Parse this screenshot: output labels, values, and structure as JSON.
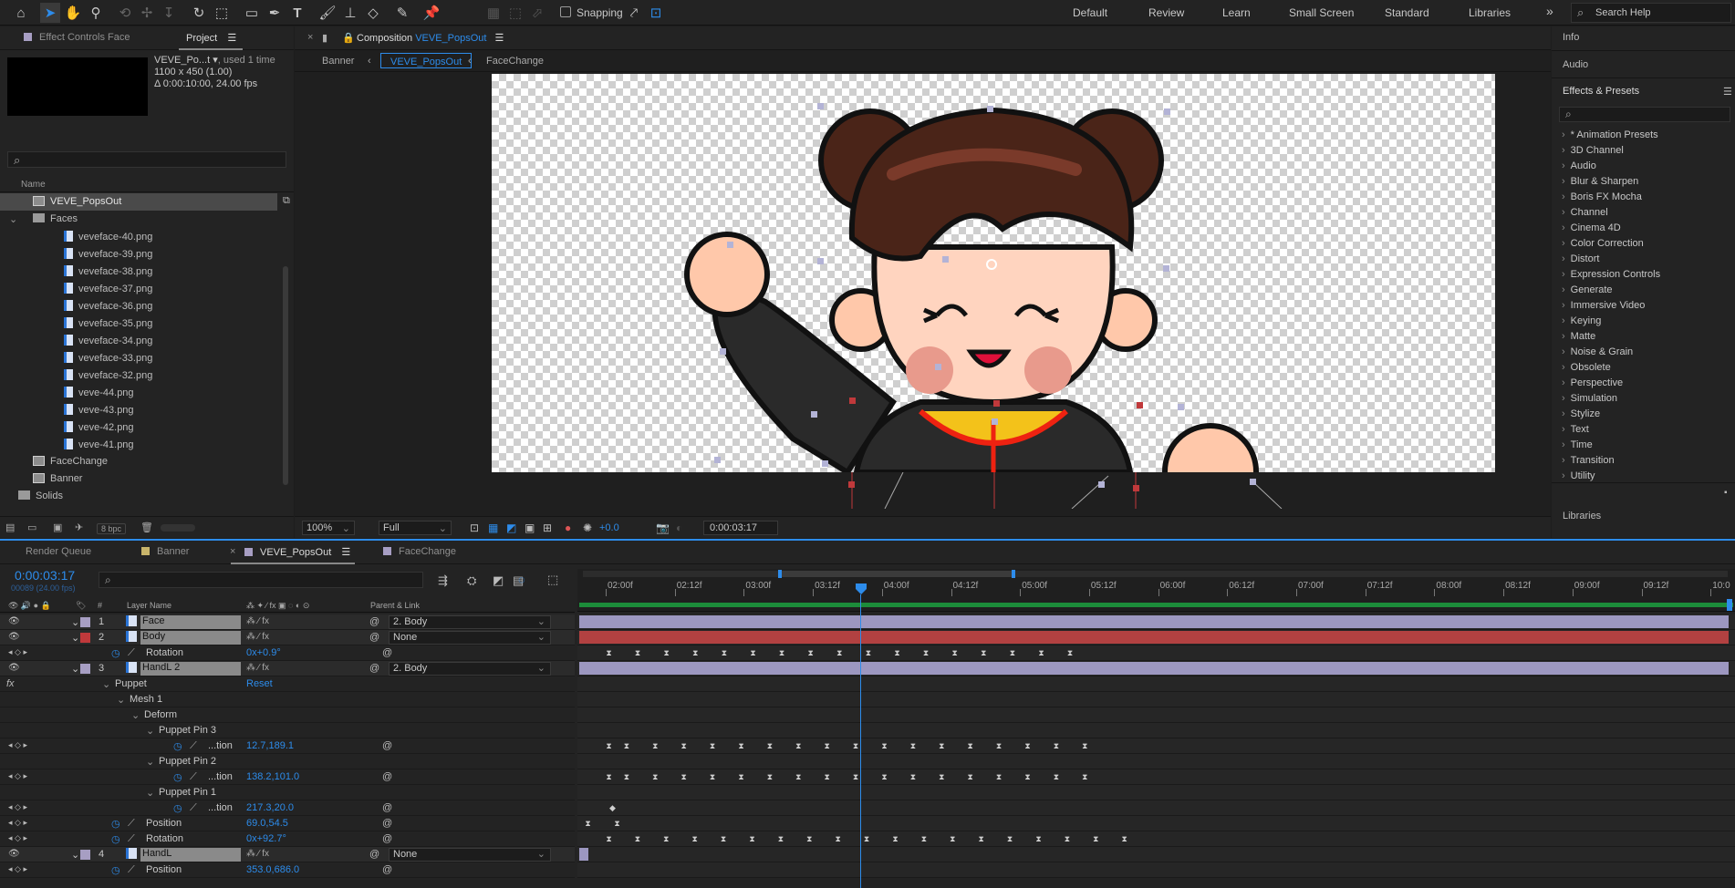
{
  "toolbar": {
    "snapping_label": "Snapping",
    "workspaces": [
      "Default",
      "Review",
      "Learn",
      "Small Screen",
      "Standard",
      "Libraries"
    ],
    "more": "»",
    "search_placeholder": "Search Help"
  },
  "project": {
    "tabs": {
      "effect_controls": "Effect Controls Face",
      "project": "Project"
    },
    "info": {
      "name": "VEVE_Po...t ▾",
      "used": ", used 1 time",
      "dimensions": "1100 x 450 (1.00)",
      "duration": "Δ 0:00:10:00, 24.00 fps"
    },
    "search_icon": "⌕",
    "column_name": "Name",
    "items": [
      {
        "label": "VEVE_PopsOut",
        "kind": "comp",
        "depth": 1,
        "selected": true
      },
      {
        "label": "Faces",
        "kind": "folder",
        "depth": 1,
        "expand": "⌄"
      },
      {
        "label": "veveface-40.png",
        "kind": "file",
        "depth": 2
      },
      {
        "label": "veveface-39.png",
        "kind": "file",
        "depth": 2
      },
      {
        "label": "veveface-38.png",
        "kind": "file",
        "depth": 2
      },
      {
        "label": "veveface-37.png",
        "kind": "file",
        "depth": 2
      },
      {
        "label": "veveface-36.png",
        "kind": "file",
        "depth": 2
      },
      {
        "label": "veveface-35.png",
        "kind": "file",
        "depth": 2
      },
      {
        "label": "veveface-34.png",
        "kind": "file",
        "depth": 2
      },
      {
        "label": "veveface-33.png",
        "kind": "file",
        "depth": 2
      },
      {
        "label": "veveface-32.png",
        "kind": "file",
        "depth": 2
      },
      {
        "label": "veve-44.png",
        "kind": "file",
        "depth": 2
      },
      {
        "label": "veve-43.png",
        "kind": "file",
        "depth": 2
      },
      {
        "label": "veve-42.png",
        "kind": "file",
        "depth": 2
      },
      {
        "label": "veve-41.png",
        "kind": "file",
        "depth": 2
      },
      {
        "label": "FaceChange",
        "kind": "comp",
        "depth": 1
      },
      {
        "label": "Banner",
        "kind": "comp",
        "depth": 1
      },
      {
        "label": "Solids",
        "kind": "folder",
        "depth": 0,
        "expand": "›"
      }
    ],
    "bpc": "8 bpc"
  },
  "composition": {
    "tab_prefix": "Composition",
    "tab_name": "VEVE_PopsOut",
    "breadcrumbs": [
      "Banner",
      "VEVE_PopsOut",
      "FaceChange"
    ],
    "footer": {
      "zoom": "100%",
      "quality": "Full",
      "exposure": "+0.0",
      "time": "0:00:03:17"
    }
  },
  "right": {
    "info": "Info",
    "audio": "Audio",
    "effects_title": "Effects & Presets",
    "search_icon": "⌕",
    "effects": [
      "* Animation Presets",
      "3D Channel",
      "Audio",
      "Blur & Sharpen",
      "Boris FX Mocha",
      "Channel",
      "Cinema 4D",
      "Color Correction",
      "Distort",
      "Expression Controls",
      "Generate",
      "Immersive Video",
      "Keying",
      "Matte",
      "Noise & Grain",
      "Obsolete",
      "Perspective",
      "Simulation",
      "Stylize",
      "Text",
      "Time",
      "Transition",
      "Utility"
    ],
    "libraries": "Libraries"
  },
  "timeline": {
    "tabs": [
      "Render Queue",
      "Banner",
      "VEVE_PopsOut",
      "FaceChange"
    ],
    "close": "×",
    "timecode": "0:00:03:17",
    "frames": "00089 (24.00 fps)",
    "headers": {
      "num": "#",
      "layer_name": "Layer Name",
      "parent": "Parent & Link"
    },
    "ticks": [
      "02:00f",
      "02:12f",
      "03:00f",
      "03:12f",
      "04:00f",
      "04:12f",
      "05:00f",
      "05:12f",
      "06:00f",
      "06:12f",
      "07:00f",
      "07:12f",
      "08:00f",
      "08:12f",
      "09:00f",
      "09:12f",
      "10:0"
    ],
    "rows": [
      {
        "type": "layer",
        "num": "1",
        "name": "Face",
        "parent": "2. Body",
        "color": "#a79ec3",
        "bar": "#9c97c0",
        "icon": "comp"
      },
      {
        "type": "layer",
        "num": "2",
        "name": "Body",
        "parent": "None",
        "color": "#c0393b",
        "bar": "#b24141",
        "icon": "file"
      },
      {
        "type": "prop",
        "name": "Rotation",
        "value": "0x+0.9°",
        "indent": 1
      },
      {
        "type": "layer",
        "num": "3",
        "name": "HandL 2",
        "parent": "2. Body",
        "color": "#a79ec3",
        "bar": "#9c97c0",
        "icon": "file"
      },
      {
        "type": "effect",
        "name": "Puppet",
        "value": "Reset"
      },
      {
        "type": "group",
        "name": "Mesh 1",
        "indent": 2
      },
      {
        "type": "group",
        "name": "Deform",
        "indent": 3
      },
      {
        "type": "group",
        "name": "Puppet Pin 3",
        "indent": 4
      },
      {
        "type": "prop",
        "name": "...tion",
        "value": "12.7,189.1",
        "indent": 5
      },
      {
        "type": "group",
        "name": "Puppet Pin 2",
        "indent": 4
      },
      {
        "type": "prop",
        "name": "...tion",
        "value": "138.2,101.0",
        "indent": 5
      },
      {
        "type": "group",
        "name": "Puppet Pin 1",
        "indent": 4
      },
      {
        "type": "prop",
        "name": "...tion",
        "value": "217.3,20.0",
        "indent": 5
      },
      {
        "type": "prop",
        "name": "Position",
        "value": "69.0,54.5",
        "indent": 1
      },
      {
        "type": "prop",
        "name": "Rotation",
        "value": "0x+92.7°",
        "indent": 1
      },
      {
        "type": "layer",
        "num": "4",
        "name": "HandL",
        "parent": "None",
        "color": "#a79ec3",
        "bar": "#9c97c0",
        "icon": "file"
      },
      {
        "type": "prop",
        "name": "Position",
        "value": "353.0,686.0",
        "indent": 1
      }
    ]
  }
}
